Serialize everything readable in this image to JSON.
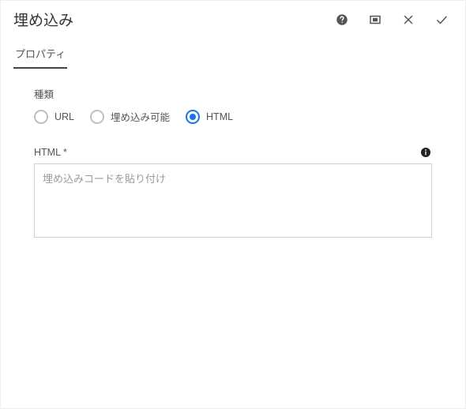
{
  "header": {
    "title": "埋め込み"
  },
  "tabs": {
    "properties": "プロパティ"
  },
  "fields": {
    "type_label": "種類",
    "radio": {
      "url": "URL",
      "embeddable": "埋め込み可能",
      "html": "HTML",
      "selected": "html"
    },
    "html_label": "HTML *",
    "html_placeholder": "埋め込みコードを貼り付け",
    "html_value": ""
  }
}
